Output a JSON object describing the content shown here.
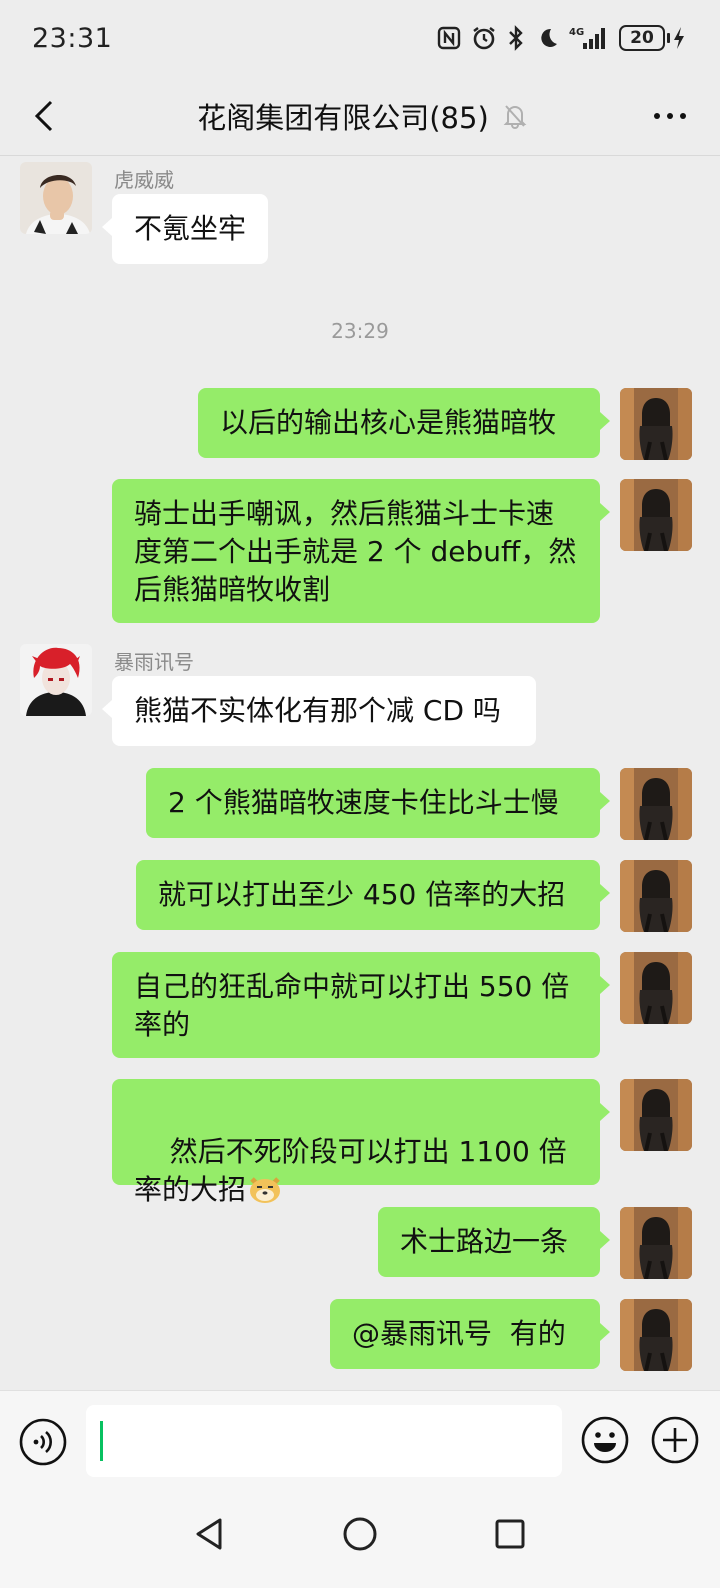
{
  "status": {
    "time": "23:31",
    "battery": "20"
  },
  "header": {
    "title": "花阁集团有限公司(85)"
  },
  "messages": [
    {
      "sender": "虎威威",
      "text": "不氪坐牢"
    },
    {
      "text": "以后的输出核心是熊猫暗牧"
    },
    {
      "text": "骑士出手嘲讽，然后熊猫斗士卡速度第二个出手就是 2 个 debuff，然后熊猫暗牧收割"
    },
    {
      "sender": "暴雨讯号",
      "text": "熊猫不实体化有那个减 CD 吗"
    },
    {
      "text": "2 个熊猫暗牧速度卡住比斗士慢"
    },
    {
      "text": "就可以打出至少 450 倍率的大招"
    },
    {
      "text": "自己的狂乱命中就可以打出 550 倍率的"
    },
    {
      "text": "然后不死阶段可以打出 1100 倍率的大招"
    },
    {
      "text": "术士路边一条"
    },
    {
      "text": "@暴雨讯号  有的"
    }
  ],
  "time_separator": "23:29",
  "colors": {
    "outgoing_bubble": "#95ec69",
    "incoming_bubble": "#ffffff",
    "background": "#ededed",
    "caret": "#07c160"
  },
  "icons": {
    "back": "chevron-left-icon",
    "more": "more-dots-icon",
    "mute": "bell-muted-icon",
    "voice": "voice-icon",
    "emoji": "emoji-icon",
    "plus": "plus-icon"
  }
}
